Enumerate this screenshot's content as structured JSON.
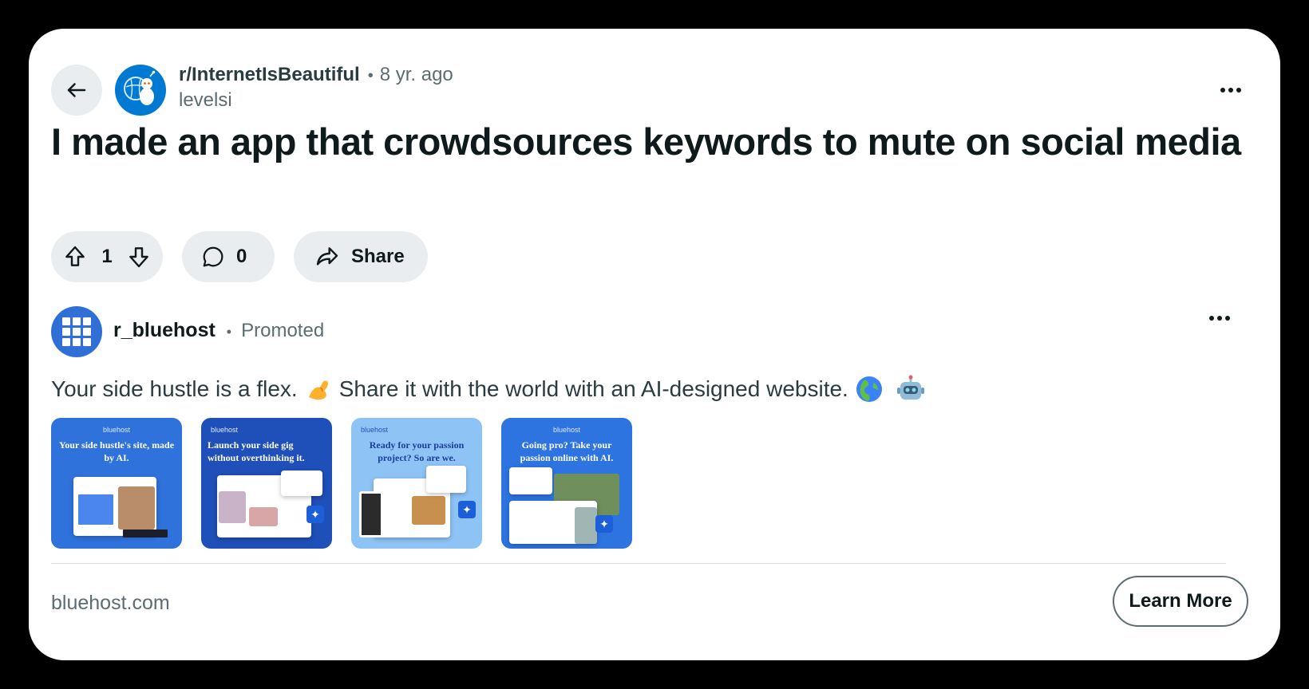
{
  "post": {
    "subreddit": "r/InternetIsBeautiful",
    "separator": "•",
    "time_ago": "8 yr. ago",
    "author": "levelsi",
    "title": "I made an app that crowdsources keywords to mute on social media",
    "upvote_count": "1",
    "comment_count": "0",
    "share_label": "Share"
  },
  "icons": {
    "back": "arrow-left-icon",
    "subreddit_avatar": "subreddit-avatar-icon",
    "more": "ellipsis-icon",
    "upvote": "arrow-up-outline-icon",
    "downvote": "arrow-down-outline-icon",
    "comment": "speech-bubble-icon",
    "share": "share-arrow-icon",
    "ad_avatar": "grid-logo-icon"
  },
  "promoted": {
    "advertiser": "r_bluehost",
    "separator": "•",
    "label": "Promoted",
    "text_part1": "Your side hustle is a flex.",
    "text_part2": "Share it with the world with an AI-designed website.",
    "emojis": [
      "flexed-biceps",
      "globe-europe-africa",
      "robot-face"
    ],
    "domain": "bluehost.com",
    "cta_label": "Learn More",
    "carousel": [
      {
        "brand": "bluehost",
        "headline": "Your side hustle's site, made by AI."
      },
      {
        "brand": "bluehost",
        "headline": "Launch your side gig without overthinking it."
      },
      {
        "brand": "bluehost",
        "headline": "Ready for your passion project? So are we."
      },
      {
        "brand": "bluehost",
        "headline": "Going pro? Take your passion online with AI."
      }
    ]
  },
  "colors": {
    "background": "#000000",
    "card": "#ffffff",
    "pill": "#eaedef",
    "subreddit_blue": "#0079d3",
    "bluehost_blue": "#2f6fd6",
    "text_primary": "#0f1a1c",
    "text_secondary": "#5c6c74"
  }
}
